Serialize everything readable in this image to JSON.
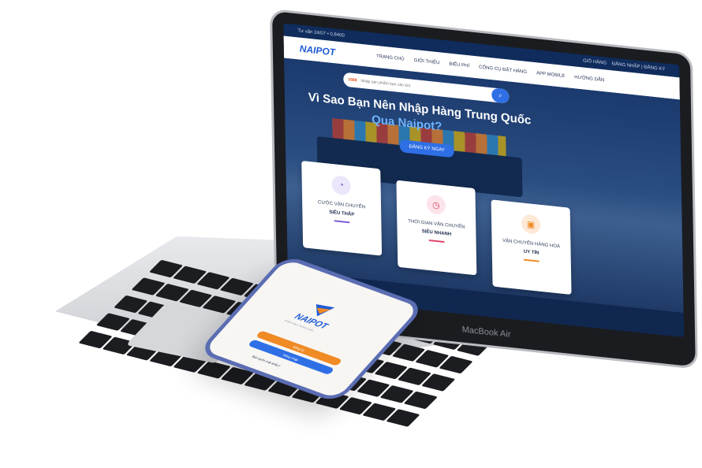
{
  "site": {
    "topbar": {
      "hotline": "Tư vấn 24/07 • 0,8400",
      "cart": "GIỎ HÀNG",
      "login": "ĐĂNG NHẬP",
      "register": "ĐĂNG KÝ"
    },
    "logo": "NAIPOT",
    "nav": [
      {
        "label": "TRANG CHỦ"
      },
      {
        "label": "GIỚI THIỆU"
      },
      {
        "label": "BIỂU PHÍ"
      },
      {
        "label": "CÔNG CỤ ĐẶT HÀNG"
      },
      {
        "label": "APP MOBILE"
      },
      {
        "label": "HƯỚNG DẪN"
      }
    ],
    "search": {
      "brand": "1688",
      "placeholder": "Nhập sản phẩm bạn cần tìm"
    },
    "hero": {
      "title_line1": "Vì Sao Bạn Nên Nhập Hàng Trung Quốc",
      "title_line2": "Qua Naipot?",
      "cta": "ĐĂNG KÝ NGAY"
    },
    "cards": [
      {
        "title": "CƯỚC VẬN CHUYỂN",
        "subtitle": "SIÊU THẤP",
        "icon": "piggy-bank-icon",
        "color": "#7b5cd6",
        "bg": "#ece6fb"
      },
      {
        "title": "THỜI GIAN VẬN CHUYỂN",
        "subtitle": "SIÊU NHANH",
        "icon": "stopwatch-icon",
        "color": "#e0456b",
        "bg": "#fde4ea"
      },
      {
        "title": "VẬN CHUYỂN HÀNG HOÁ",
        "subtitle": "UY TÍN",
        "icon": "delivery-truck-icon",
        "color": "#f08a24",
        "bg": "#fde9d6"
      }
    ]
  },
  "laptop": {
    "label": "MacBook Air"
  },
  "phone": {
    "logo": "NAIPOT",
    "tagline": "NHẬP HÀNG TRUNG QUỐC",
    "btn_primary": "Đăng ký",
    "btn_secondary": "Đăng nhập",
    "forgot": "Bạn quên mật khẩu?"
  }
}
